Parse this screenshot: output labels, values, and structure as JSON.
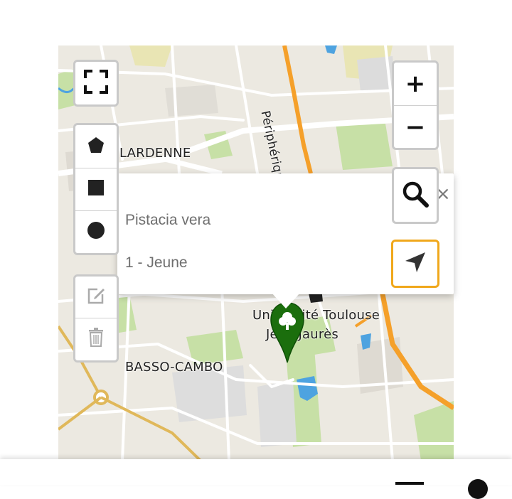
{
  "map": {
    "labels": {
      "road": "Périphérique Exté",
      "district_1": "LARDENNE",
      "district_2": "BASSO-CAMBO",
      "university_line1": "Université Toulouse",
      "university_line2": "Jean Jaurès"
    },
    "marker_icon": "tree-marker-icon",
    "colors": {
      "background": "#ece9e1",
      "highway": "#f5a02a",
      "ring_road": "#e0b85a",
      "park": "#c7e0a6",
      "water": "#4ea3e0",
      "marker": "#1b6e0d",
      "active_border": "#f0a81c"
    }
  },
  "controls": {
    "fullscreen_icon": "fullscreen-icon",
    "draw_polygon_icon": "polygon-icon",
    "draw_rectangle_icon": "square-icon",
    "draw_circle_icon": "circle-icon",
    "edit_icon": "edit-icon",
    "delete_icon": "trash-icon",
    "zoom_in_label": "+",
    "zoom_out_label": "−",
    "search_icon": "search-icon",
    "locate_icon": "locate-arrow-icon"
  },
  "popup": {
    "species": "Pistacia vera",
    "age_class": "1 - Jeune",
    "close_label": "×"
  }
}
